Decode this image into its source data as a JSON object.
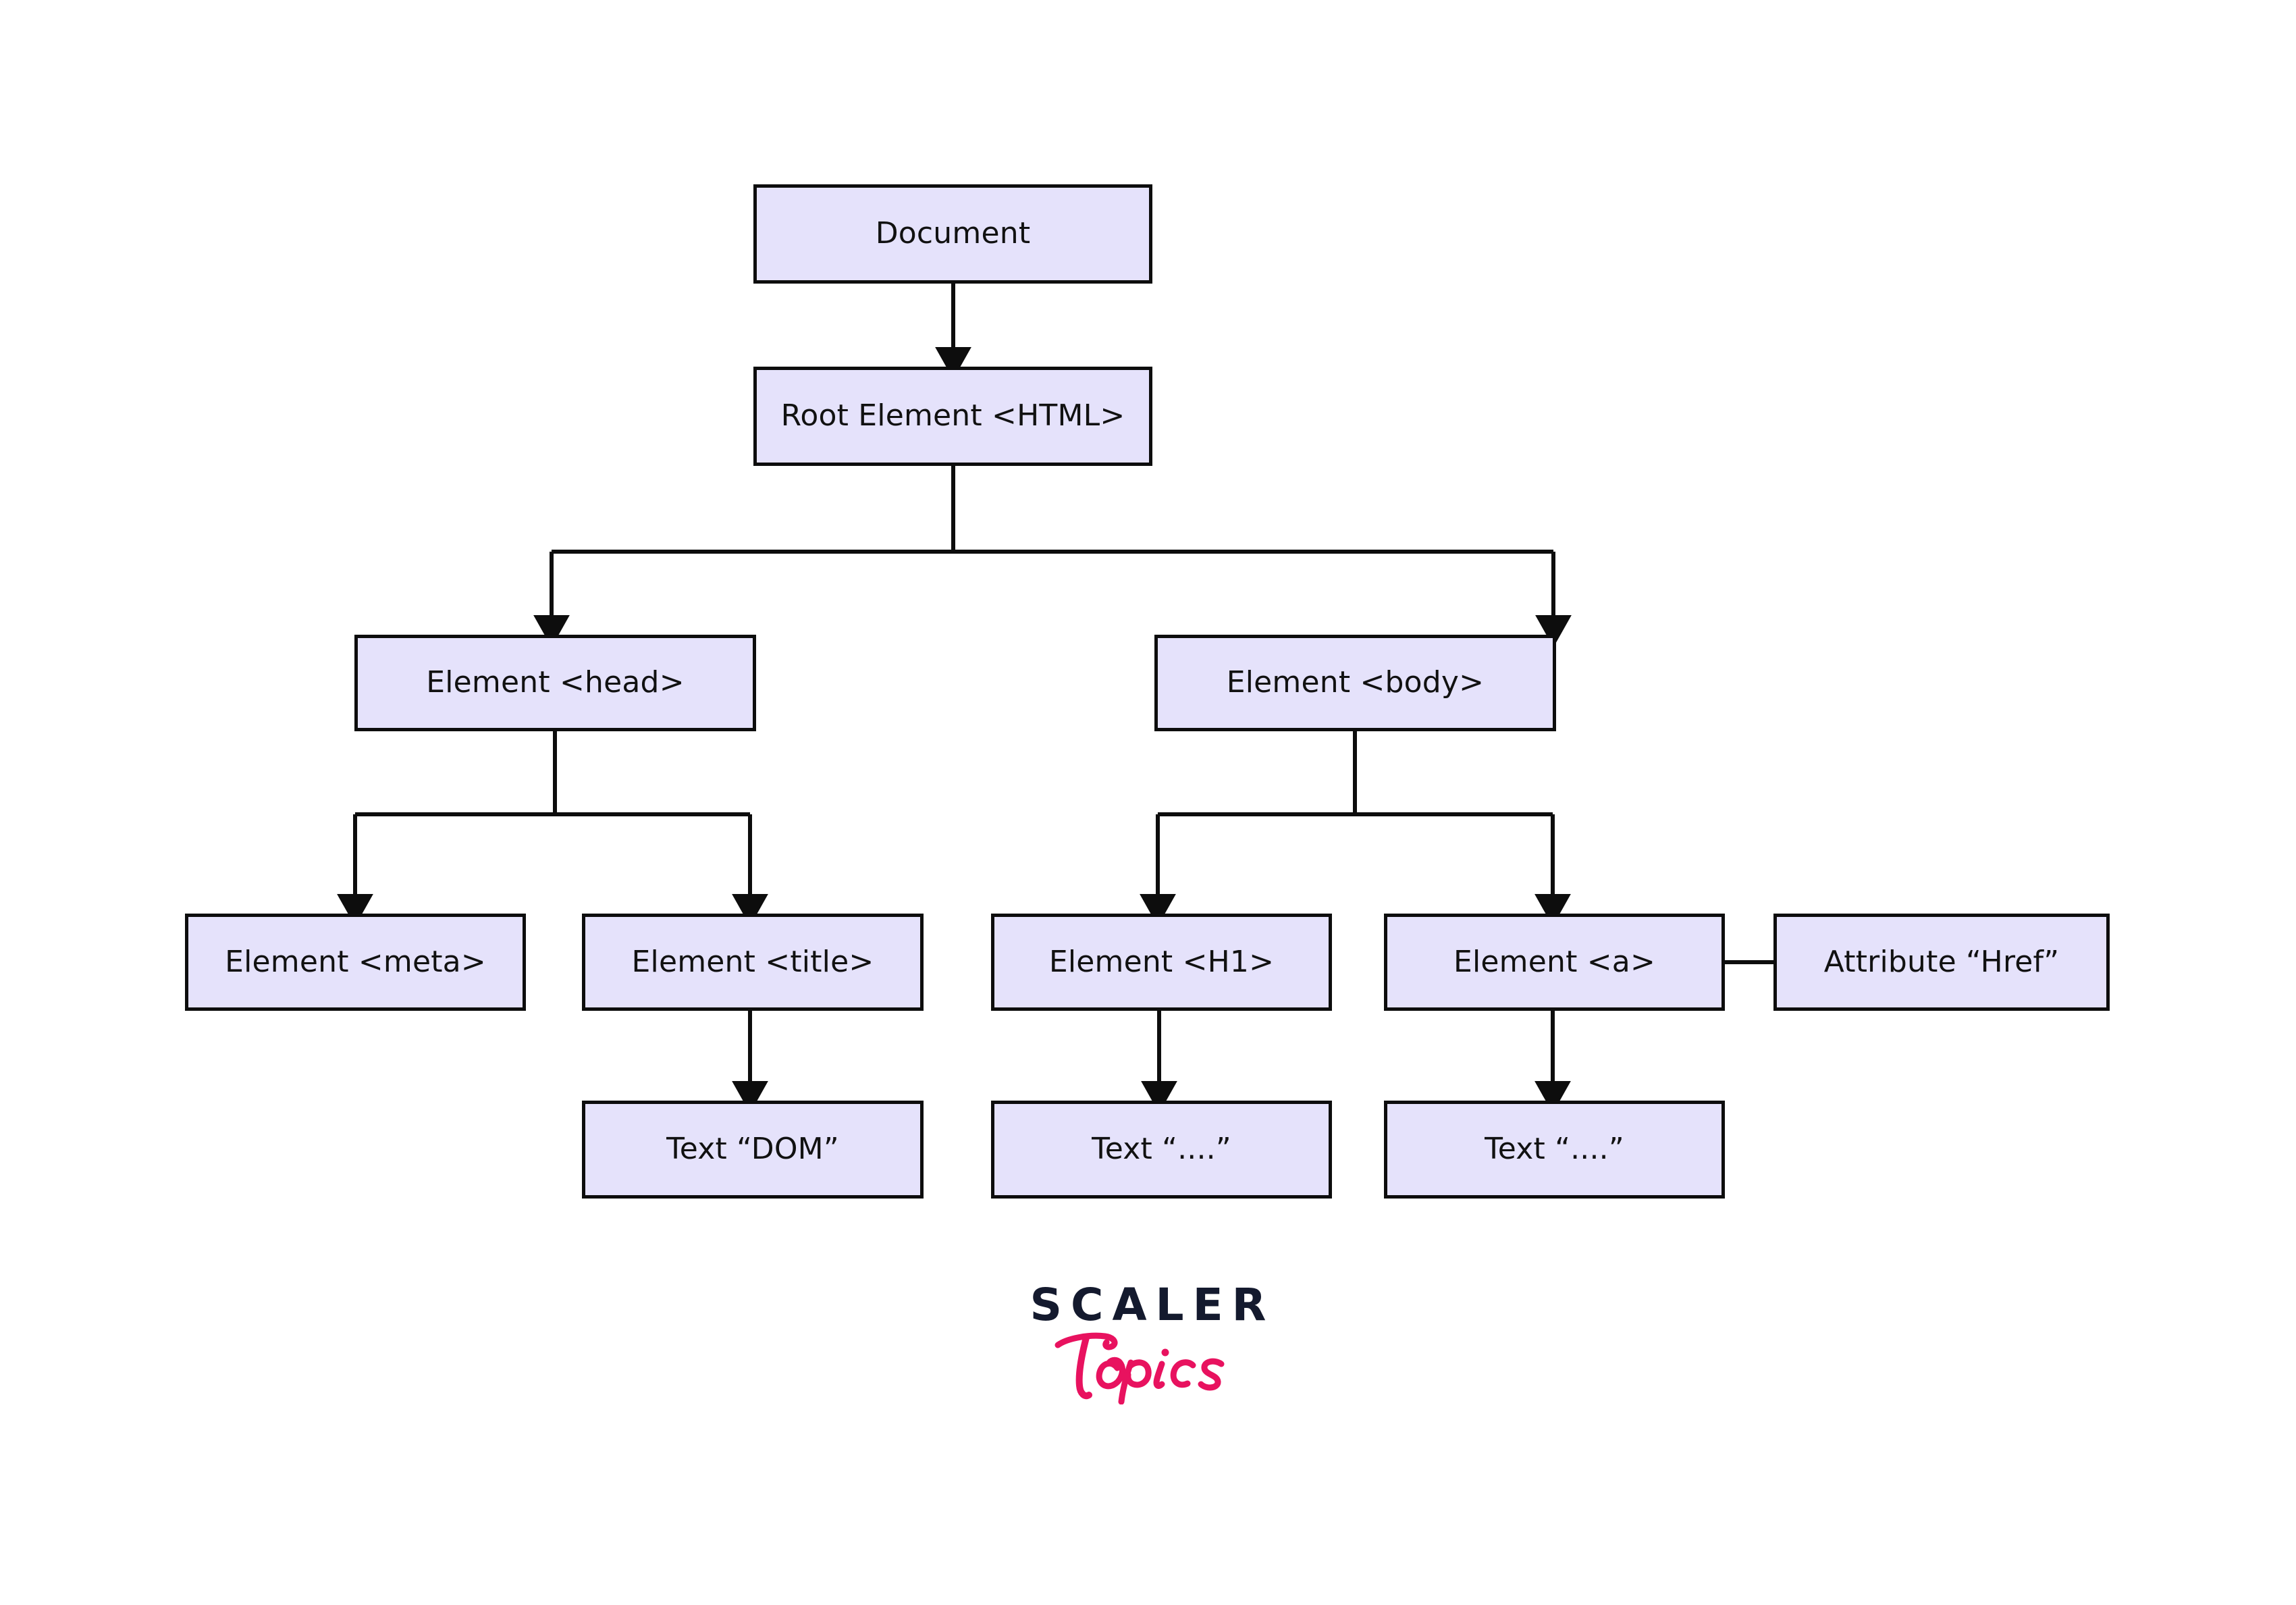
{
  "diagram": {
    "type": "dom-tree",
    "title": "DOM Tree Structure",
    "colors": {
      "node_fill": "#e5e2fb",
      "node_border": "#0d0d0d",
      "connector": "#0d0d0d",
      "logo_scaler": "#141a2e",
      "logo_topics": "#e8125f",
      "background": "#ffffff"
    },
    "nodes": [
      {
        "id": "document",
        "label": "Document"
      },
      {
        "id": "html",
        "label": "Root Element <HTML>"
      },
      {
        "id": "head",
        "label": "Element <head>"
      },
      {
        "id": "body",
        "label": "Element <body>"
      },
      {
        "id": "meta",
        "label": "Element <meta>"
      },
      {
        "id": "title",
        "label": "Element <title>"
      },
      {
        "id": "h1",
        "label": "Element <H1>"
      },
      {
        "id": "anchor",
        "label": "Element <a>"
      },
      {
        "id": "href",
        "label": "Attribute “Href”"
      },
      {
        "id": "text_dom",
        "label": "Text “DOM”"
      },
      {
        "id": "text_h1",
        "label": "Text “....”"
      },
      {
        "id": "text_a",
        "label": "Text “....”"
      }
    ],
    "edges": [
      {
        "from": "document",
        "to": "html",
        "arrow": true
      },
      {
        "from": "html",
        "to": "head",
        "arrow": true
      },
      {
        "from": "html",
        "to": "body",
        "arrow": true
      },
      {
        "from": "head",
        "to": "meta",
        "arrow": true
      },
      {
        "from": "head",
        "to": "title",
        "arrow": true
      },
      {
        "from": "body",
        "to": "h1",
        "arrow": true
      },
      {
        "from": "body",
        "to": "anchor",
        "arrow": true
      },
      {
        "from": "anchor",
        "to": "href",
        "arrow": false
      },
      {
        "from": "title",
        "to": "text_dom",
        "arrow": true
      },
      {
        "from": "h1",
        "to": "text_h1",
        "arrow": true
      },
      {
        "from": "anchor",
        "to": "text_a",
        "arrow": true
      }
    ]
  },
  "logo": {
    "primary": "SCALER",
    "secondary": "Topics"
  }
}
